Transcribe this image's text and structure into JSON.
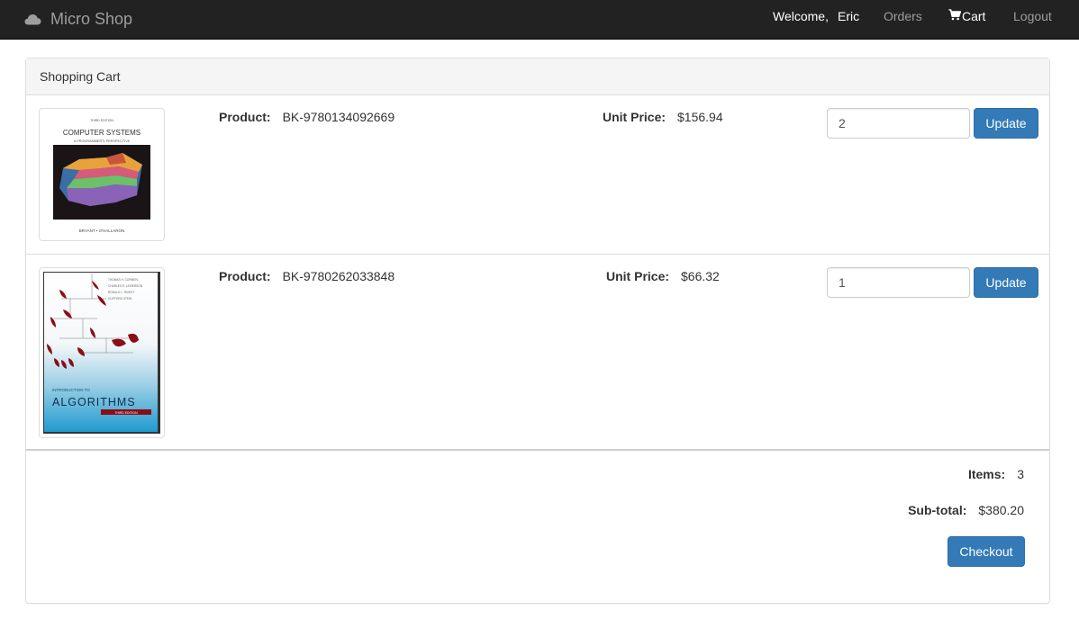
{
  "navbar": {
    "brand": "Micro Shop",
    "brand_icon": "cloud-icon",
    "welcome": "Welcome,",
    "username": "Eric",
    "orders": "Orders",
    "cart": "Cart",
    "cart_icon": "shopping-cart-icon",
    "logout": "Logout",
    "bg_color": "#222222"
  },
  "panel": {
    "heading": "Shopping Cart"
  },
  "cart": {
    "product_label": "Product:",
    "unit_price_label": "Unit Price:",
    "update_label": "Update",
    "items": [
      {
        "product": "BK-9780134092669",
        "unit_price": "$156.94",
        "quantity": "2",
        "cover": {
          "edition": "THIRD EDITION",
          "title": "COMPUTER SYSTEMS",
          "subtitle": "A PROGRAMMER'S PERSPECTIVE",
          "authors": "BRYANT • O'HALLARON"
        }
      },
      {
        "product": "BK-9780262033848",
        "unit_price": "$66.32",
        "quantity": "1",
        "cover": {
          "authors": [
            "THOMAS H. CORMEN",
            "CHARLES E. LEISERSON",
            "RONALD L. RIVEST",
            "CLIFFORD STEIN"
          ],
          "intro": "INTRODUCTION TO",
          "title": "ALGORITHMS",
          "edition": "THIRD EDITION"
        }
      }
    ]
  },
  "summary": {
    "items_label": "Items:",
    "items_value": "3",
    "subtotal_label": "Sub-total:",
    "subtotal_value": "$380.20",
    "checkout_label": "Checkout"
  },
  "colors": {
    "primary": "#337ab7",
    "panel_heading_bg": "#f5f5f5"
  }
}
